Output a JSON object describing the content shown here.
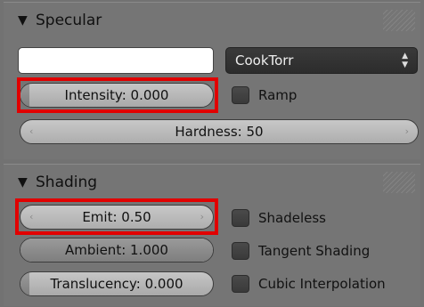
{
  "colors": {
    "highlight": "#e10000",
    "panel": "#757575"
  },
  "specular": {
    "title": "Specular",
    "shader": "CookTorr",
    "intensity_label": "Intensity: 0.000",
    "intensity_value": 0.0,
    "ramp_label": "Ramp",
    "hardness_label": "Hardness: 50"
  },
  "shading": {
    "title": "Shading",
    "emit_label": "Emit: 0.50",
    "ambient_label": "Ambient: 1.000",
    "ambient_value": 1.0,
    "translucency_label": "Translucency: 0.000",
    "translucency_value": 0.0,
    "shadeless_label": "Shadeless",
    "tangent_label": "Tangent Shading",
    "cubic_label": "Cubic Interpolation"
  },
  "icons": {
    "collapse": "triangle-down-icon",
    "dropdown": "updown-arrows-icon",
    "decrement": "chevron-left-icon",
    "increment": "chevron-right-icon"
  }
}
